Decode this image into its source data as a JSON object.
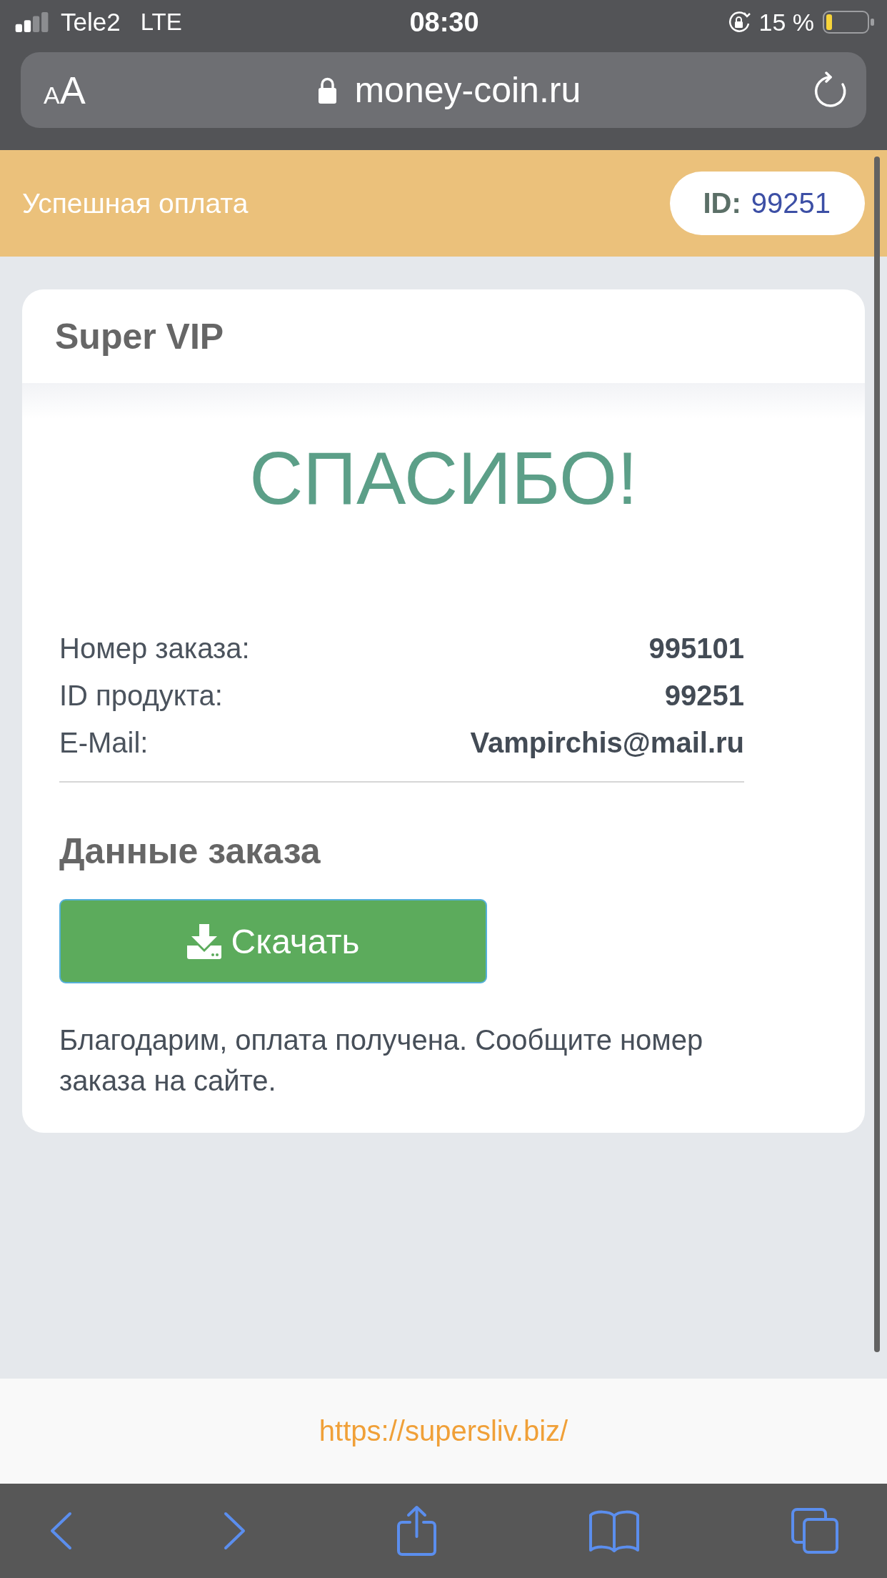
{
  "status_bar": {
    "carrier": "Tele2",
    "network": "LTE",
    "time": "08:30",
    "battery": "15 %"
  },
  "address_bar": {
    "text_size_button": [
      "A",
      "A"
    ],
    "url": "money-coin.ru"
  },
  "banner": {
    "title": "Успешная оплата",
    "id_label": "ID:",
    "id_value": "99251"
  },
  "card": {
    "title": "Super VIP",
    "heading": "СПАСИБО!",
    "details": [
      {
        "label": "Номер заказа:",
        "value": "995101"
      },
      {
        "label": "ID продукта:",
        "value": "99251"
      },
      {
        "label": "E-Mail:",
        "value": "Vampirchis@mail.ru"
      }
    ],
    "section_title": "Данные заказа",
    "download_button": "Скачать",
    "message": "Благодарим, оплата получена. Сообщите номер заказа на сайте."
  },
  "footer": {
    "link": "https://supersliv.biz/"
  }
}
